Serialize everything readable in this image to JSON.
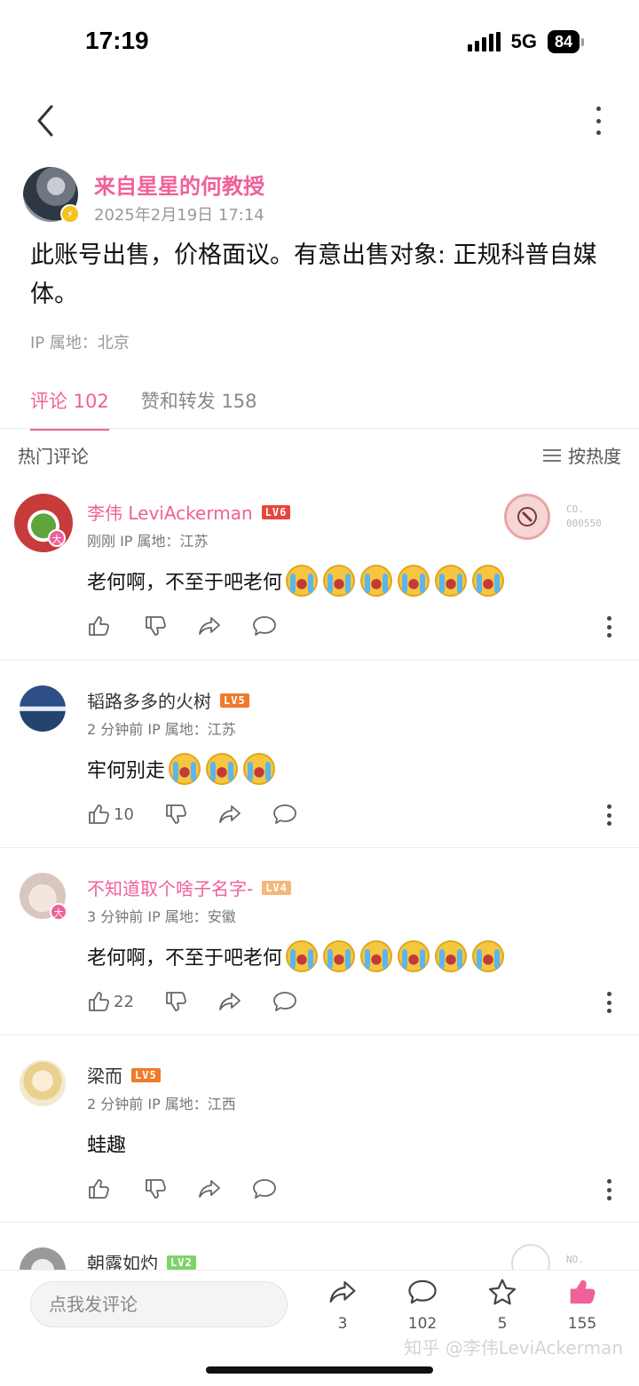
{
  "status": {
    "time": "17:19",
    "network": "5G",
    "battery": "84"
  },
  "post": {
    "author": "来自星星的何教授",
    "time": "2025年2月19日 17:14",
    "content": "此账号出售，价格面议。有意出售对象: 正规科普自媒体。",
    "ip": "IP 属地：北京"
  },
  "tabs": [
    {
      "label": "评论 102"
    },
    {
      "label": "赞和转发 158"
    }
  ],
  "section": {
    "title": "热门评论",
    "sort_label": "按热度"
  },
  "comments": [
    {
      "name": "李伟 LeviAckerman",
      "level": "LV6",
      "meta": "刚刚  IP 属地：江苏",
      "text": "老何啊，不至于吧老何",
      "emoji_count": 6,
      "likes": "",
      "medal_text": "CO. 000550",
      "badge": "大"
    },
    {
      "name": "韬路多多的火树",
      "level": "LV5",
      "meta": "2 分钟前  IP 属地：江苏",
      "text": "牢何别走",
      "emoji_count": 3,
      "likes": "10"
    },
    {
      "name": "不知道取个啥子名字-",
      "level": "LV4",
      "meta": "3 分钟前  IP 属地：安徽",
      "text": "老何啊，不至于吧老何",
      "emoji_count": 6,
      "likes": "22",
      "badge": "大"
    },
    {
      "name": "梁而",
      "level": "LV5",
      "meta": "2 分钟前  IP 属地：江西",
      "text": "蛙趣",
      "emoji_count": 0,
      "likes": ""
    },
    {
      "name": "朝露如灼",
      "level": "LV2",
      "medal_text": "NO."
    }
  ],
  "bottom": {
    "placeholder": "点我发评论",
    "share_count": "3",
    "comment_count": "102",
    "star_count": "5",
    "like_count": "155"
  },
  "watermark": "知乎 @李伟LeviAckerman",
  "colors": {
    "accent": "#f0609a",
    "lv6": "#e8453c",
    "lv5": "#ef7a2a",
    "lv4": "#f4b87a",
    "lv2": "#7fd36b"
  },
  "icons": [
    "back-icon",
    "more-icon",
    "sort-icon",
    "like-icon",
    "dislike-icon",
    "share-icon",
    "comment-icon",
    "star-icon"
  ]
}
